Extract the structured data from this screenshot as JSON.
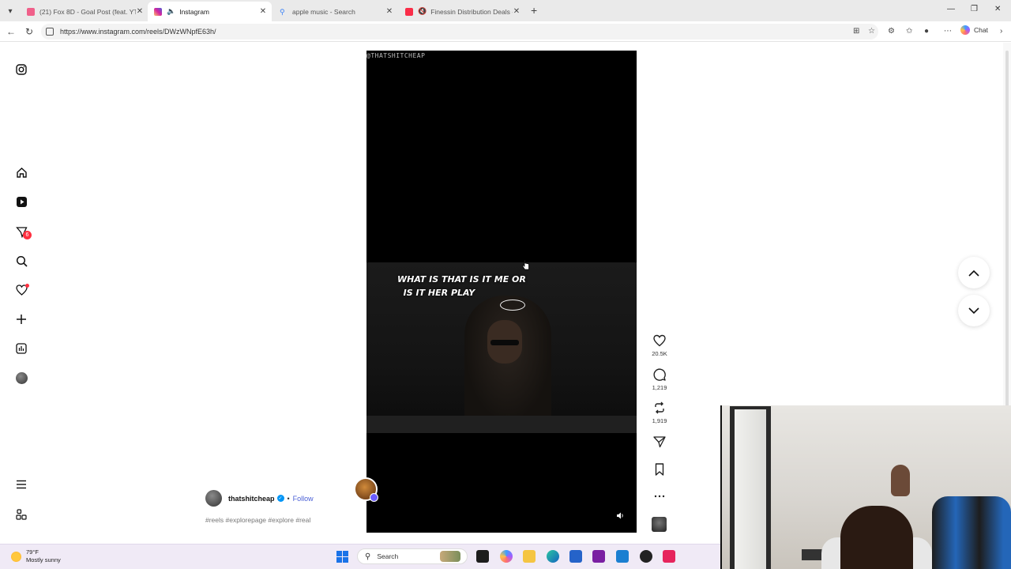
{
  "browser": {
    "tabs": [
      {
        "label": "(21) Fox 8D - Goal Post (feat. YTB",
        "active": false,
        "favicon_color": "#f0608a"
      },
      {
        "label": "Instagram",
        "active": true,
        "favicon_color": "#d6249f"
      },
      {
        "label": "apple music - Search",
        "active": false,
        "favicon_color": "#3b82f6"
      },
      {
        "label": "Finessin Distribution Deals - A",
        "active": false,
        "favicon_color": "#fa2d48"
      }
    ],
    "url": "https://www.instagram.com/reels/DWzWNpfE63h/",
    "chat_label": "Chat"
  },
  "sidebar": {
    "notifications_badge": "6"
  },
  "reel": {
    "watermark": "@THATSHITCHEAP",
    "caption": "WHAT IS THAT IS IT ME OR\n  IS IT HER PLAY",
    "likes": "20.5K",
    "comments": "1,219",
    "reposts": "1,919",
    "author": "thatshitcheap",
    "follow_label": "Follow",
    "separator": "•",
    "hashtags": "#reels #explorepage #explore #real"
  },
  "taskbar": {
    "temperature": "79°F",
    "weather": "Mostly sunny",
    "search_label": "Search"
  }
}
